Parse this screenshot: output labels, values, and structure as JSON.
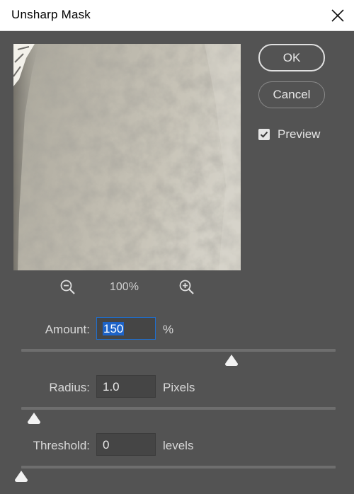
{
  "window": {
    "title": "Unsharp Mask",
    "close_icon": "close-x-icon"
  },
  "buttons": {
    "ok_label": "OK",
    "cancel_label": "Cancel"
  },
  "preview": {
    "label": "Preview",
    "checked": true,
    "zoom_level": "100%"
  },
  "fields": {
    "amount": {
      "label": "Amount:",
      "value": "150",
      "unit": "%",
      "slider_fraction": 0.67
    },
    "radius": {
      "label": "Radius:",
      "value": "1.0",
      "unit": "Pixels",
      "slider_fraction": 0.04
    },
    "threshold": {
      "label": "Threshold:",
      "value": "0",
      "unit": "levels",
      "slider_fraction": 0.0
    }
  },
  "colors": {
    "dialog_bg": "#535353",
    "input_focus": "#1f6fcf",
    "selection": "#1d63c8"
  }
}
